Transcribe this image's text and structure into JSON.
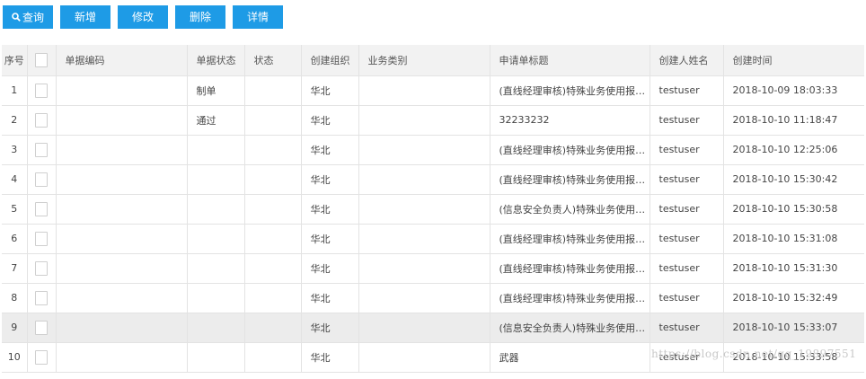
{
  "toolbar": {
    "search_label": "查询",
    "add_label": "新增",
    "edit_label": "修改",
    "delete_label": "删除",
    "detail_label": "详情"
  },
  "colors": {
    "button": "#1e9be6",
    "header_bg": "#f2f2f2",
    "highlight_row": "#ececec"
  },
  "table": {
    "columns": [
      "序号",
      "",
      "单据编码",
      "单据状态",
      "状态",
      "创建组织",
      "业务类别",
      "申请单标题",
      "创建人姓名",
      "创建时间"
    ],
    "rows": [
      {
        "seq": "1",
        "code": "",
        "doc_status": "制单",
        "status": "",
        "org": "华北",
        "biz": "",
        "title": "(直线经理审核)特殊业务使用报备-提...",
        "creator": "testuser",
        "time": "2018-10-09 18:03:33"
      },
      {
        "seq": "2",
        "code": "",
        "doc_status": "通过",
        "status": "",
        "org": "华北",
        "biz": "",
        "title": "32233232",
        "creator": "testuser",
        "time": "2018-10-10 11:18:47"
      },
      {
        "seq": "3",
        "code": "",
        "doc_status": "",
        "status": "",
        "org": "华北",
        "biz": "",
        "title": "(直线经理审核)特殊业务使用报备-提...",
        "creator": "testuser",
        "time": "2018-10-10 12:25:06"
      },
      {
        "seq": "4",
        "code": "",
        "doc_status": "",
        "status": "",
        "org": "华北",
        "biz": "",
        "title": "(直线经理审核)特殊业务使用报备-提...",
        "creator": "testuser",
        "time": "2018-10-10 15:30:42"
      },
      {
        "seq": "5",
        "code": "",
        "doc_status": "",
        "status": "",
        "org": "华北",
        "biz": "",
        "title": "(信息安全负责人)特殊业务使用报备-...",
        "creator": "testuser",
        "time": "2018-10-10 15:30:58"
      },
      {
        "seq": "6",
        "code": "",
        "doc_status": "",
        "status": "",
        "org": "华北",
        "biz": "",
        "title": "(直线经理审核)特殊业务使用报备-提...",
        "creator": "testuser",
        "time": "2018-10-10 15:31:08"
      },
      {
        "seq": "7",
        "code": "",
        "doc_status": "",
        "status": "",
        "org": "华北",
        "biz": "",
        "title": "(直线经理审核)特殊业务使用报备-提...",
        "creator": "testuser",
        "time": "2018-10-10 15:31:30"
      },
      {
        "seq": "8",
        "code": "",
        "doc_status": "",
        "status": "",
        "org": "华北",
        "biz": "",
        "title": "(直线经理审核)特殊业务使用报备-提...",
        "creator": "testuser",
        "time": "2018-10-10 15:32:49"
      },
      {
        "seq": "9",
        "code": "",
        "doc_status": "",
        "status": "",
        "org": "华北",
        "biz": "",
        "title": "(信息安全负责人)特殊业务使用报备-...",
        "creator": "testuser",
        "time": "2018-10-10 15:33:07"
      },
      {
        "seq": "10",
        "code": "",
        "doc_status": "",
        "status": "",
        "org": "华北",
        "biz": "",
        "title": "武器",
        "creator": "testuser",
        "time": "2018-10-10 15:33:58"
      }
    ]
  },
  "watermark": "https://blog.csdn.net/qq_19897551"
}
